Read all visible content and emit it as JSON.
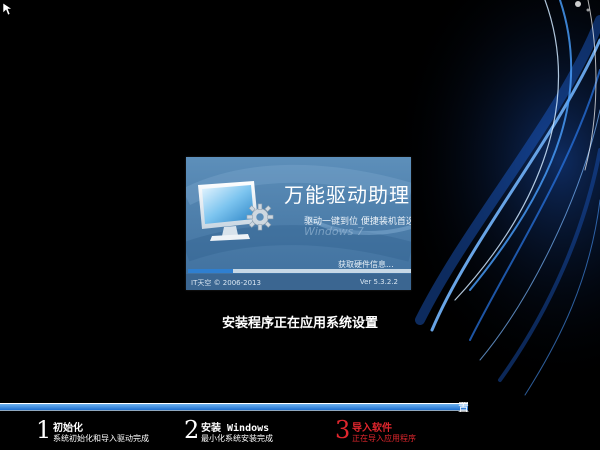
{
  "splash": {
    "title": "万能驱动助理",
    "subtitle": "驱动一键到位 便捷装机首选",
    "watermark": "Windows 7",
    "status": "获取硬件信息...",
    "progress_fraction": 0.2,
    "copyright": "IT天空 © 2006-2013",
    "version": "Ver 5.3.2.2"
  },
  "status_message": "安装程序正在应用系统设置",
  "main_progress": {
    "fraction": 1.0,
    "trailing_char": "置"
  },
  "steps": [
    {
      "number": "1",
      "title": "初始化",
      "description": "系统初始化和导入驱动完成",
      "active": false
    },
    {
      "number": "2",
      "title": "安装 Windows",
      "description": "最小化系统安装完成",
      "active": false
    },
    {
      "number": "3",
      "title": "导入软件",
      "description": "正在导入应用程序",
      "active": true
    }
  ],
  "colors": {
    "background": "#000000",
    "swirl": "#3a8fff",
    "splash_blue": "#4e7fab",
    "active_step": "#e0262d"
  },
  "icons": [
    "mouse-cursor-icon",
    "monitor-icon",
    "gear-icon"
  ]
}
